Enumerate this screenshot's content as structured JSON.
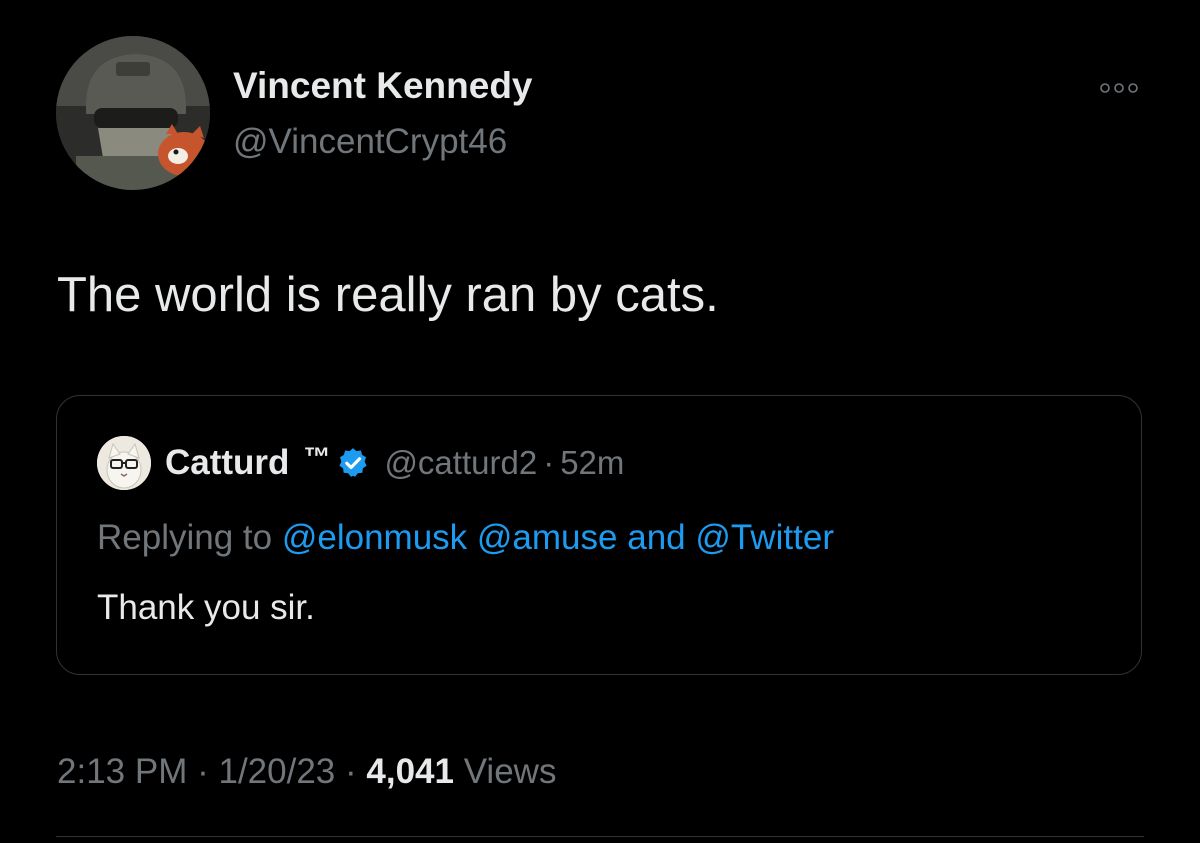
{
  "tweet": {
    "author": {
      "display_name": "Vincent Kennedy",
      "handle": "@VincentCrypt46",
      "avatar_icon": "avatar-helmet-redpanda"
    },
    "more_icon": "more-horizontal-icon",
    "text": "The world is really ran by cats.",
    "meta": {
      "time": "2:13 PM",
      "dot1": "·",
      "date": "1/20/23",
      "dot2": "·",
      "views_count": "4,041",
      "views_label": "Views"
    }
  },
  "quote": {
    "display_name": "Catturd",
    "trademark": "™",
    "verified_icon": "verified-badge-icon",
    "handle": "@catturd2",
    "dot": "·",
    "time": "52m",
    "replying_prefix": "Replying to",
    "mentions": [
      "@elonmusk",
      "@amuse"
    ],
    "and_word": "and",
    "last_mention": "@Twitter",
    "text": "Thank you sir."
  },
  "colors": {
    "background": "#000000",
    "primary_text": "#e7e9ea",
    "secondary_text": "#71767b",
    "link": "#1d9bf0",
    "border": "#2f3336"
  }
}
